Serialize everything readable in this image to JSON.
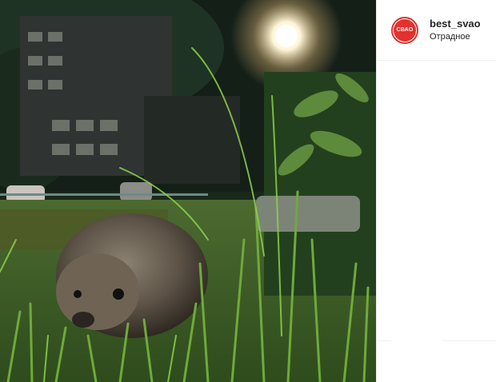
{
  "post": {
    "username": "best_svao",
    "location": "Отрадное",
    "avatar_text": "СВАО",
    "accent_color": "#e3312d"
  }
}
